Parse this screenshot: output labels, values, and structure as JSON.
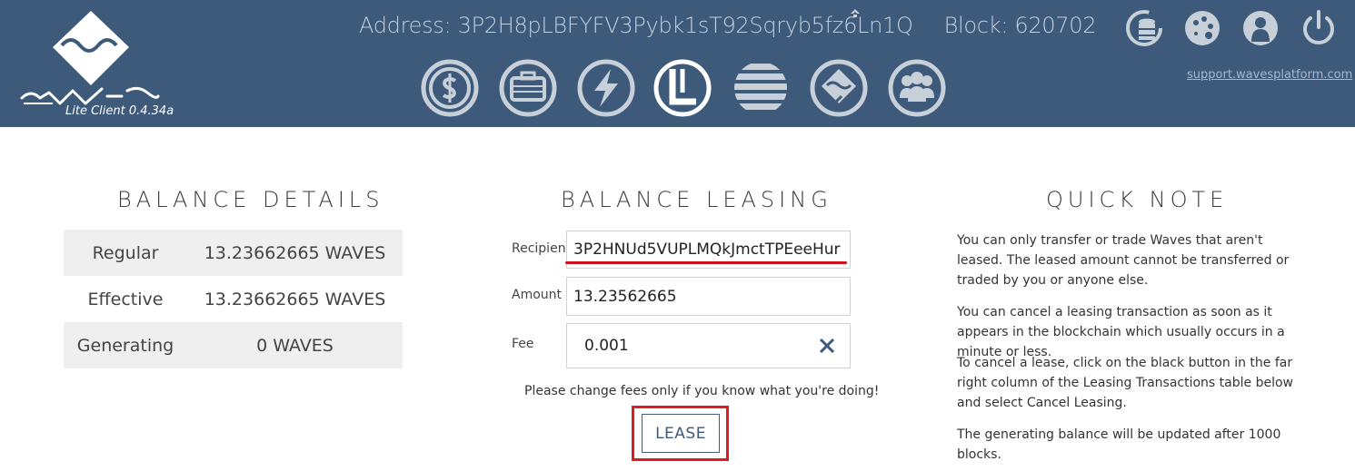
{
  "app": {
    "caption": "Lite Client 0.4.34a",
    "address_line": "Address: 3P2H8pLBFYFV3Pybk1sT92Sqryb5fz6Ln1Q",
    "block_line": "Block: 620702",
    "support_link": "support.wavesplatform.com"
  },
  "nav": {
    "items": [
      {
        "name": "wallet",
        "icon": "dollar-icon",
        "active": false
      },
      {
        "name": "portfolio",
        "icon": "briefcase-icon",
        "active": false
      },
      {
        "name": "exchange",
        "icon": "lightning-icon",
        "active": false
      },
      {
        "name": "leasing",
        "icon": "leasing-icon",
        "active": true
      },
      {
        "name": "history",
        "icon": "lines-icon",
        "active": false
      },
      {
        "name": "dex",
        "icon": "waves-logo-icon",
        "active": false
      },
      {
        "name": "community",
        "icon": "people-icon",
        "active": false
      }
    ],
    "utilities": [
      "backup-icon",
      "settings-icon",
      "account-icon",
      "power-icon"
    ]
  },
  "balance_details": {
    "title": "BALANCE DETAILS",
    "rows": [
      {
        "label": "Regular",
        "value": "13.23662665 WAVES"
      },
      {
        "label": "Effective",
        "value": "13.23662665 WAVES"
      },
      {
        "label": "Generating",
        "value": "0 WAVES"
      }
    ]
  },
  "balance_leasing": {
    "title": "BALANCE LEASING",
    "recipient_label": "Recipient",
    "recipient_value": "3P2HNUd5VUPLMQkJmctTPEeeHur",
    "amount_label": "Amount",
    "amount_value": "13.23562665",
    "fee_label": "Fee",
    "fee_value": "0.001",
    "fee_note": "Please change fees only if you know what you're doing!",
    "lease_button": "LEASE"
  },
  "quick_note": {
    "title": "QUICK NOTE",
    "paragraphs": [
      "You can only transfer or trade Waves that aren't leased. The leased amount cannot be transferred or traded by you or anyone else.",
      "You can cancel a leasing transaction as soon as it appears in the blockchain which usually occurs in a minute or less.",
      "To cancel a lease, click on the black button in the far right column of the Leasing Transactions table below and select Cancel Leasing.",
      "The generating balance will be updated after 1000 blocks."
    ]
  },
  "colors": {
    "header_bg": "#3d5a7a",
    "icon_grey": "#c7cfd9",
    "highlight_red": "#e11b22"
  }
}
